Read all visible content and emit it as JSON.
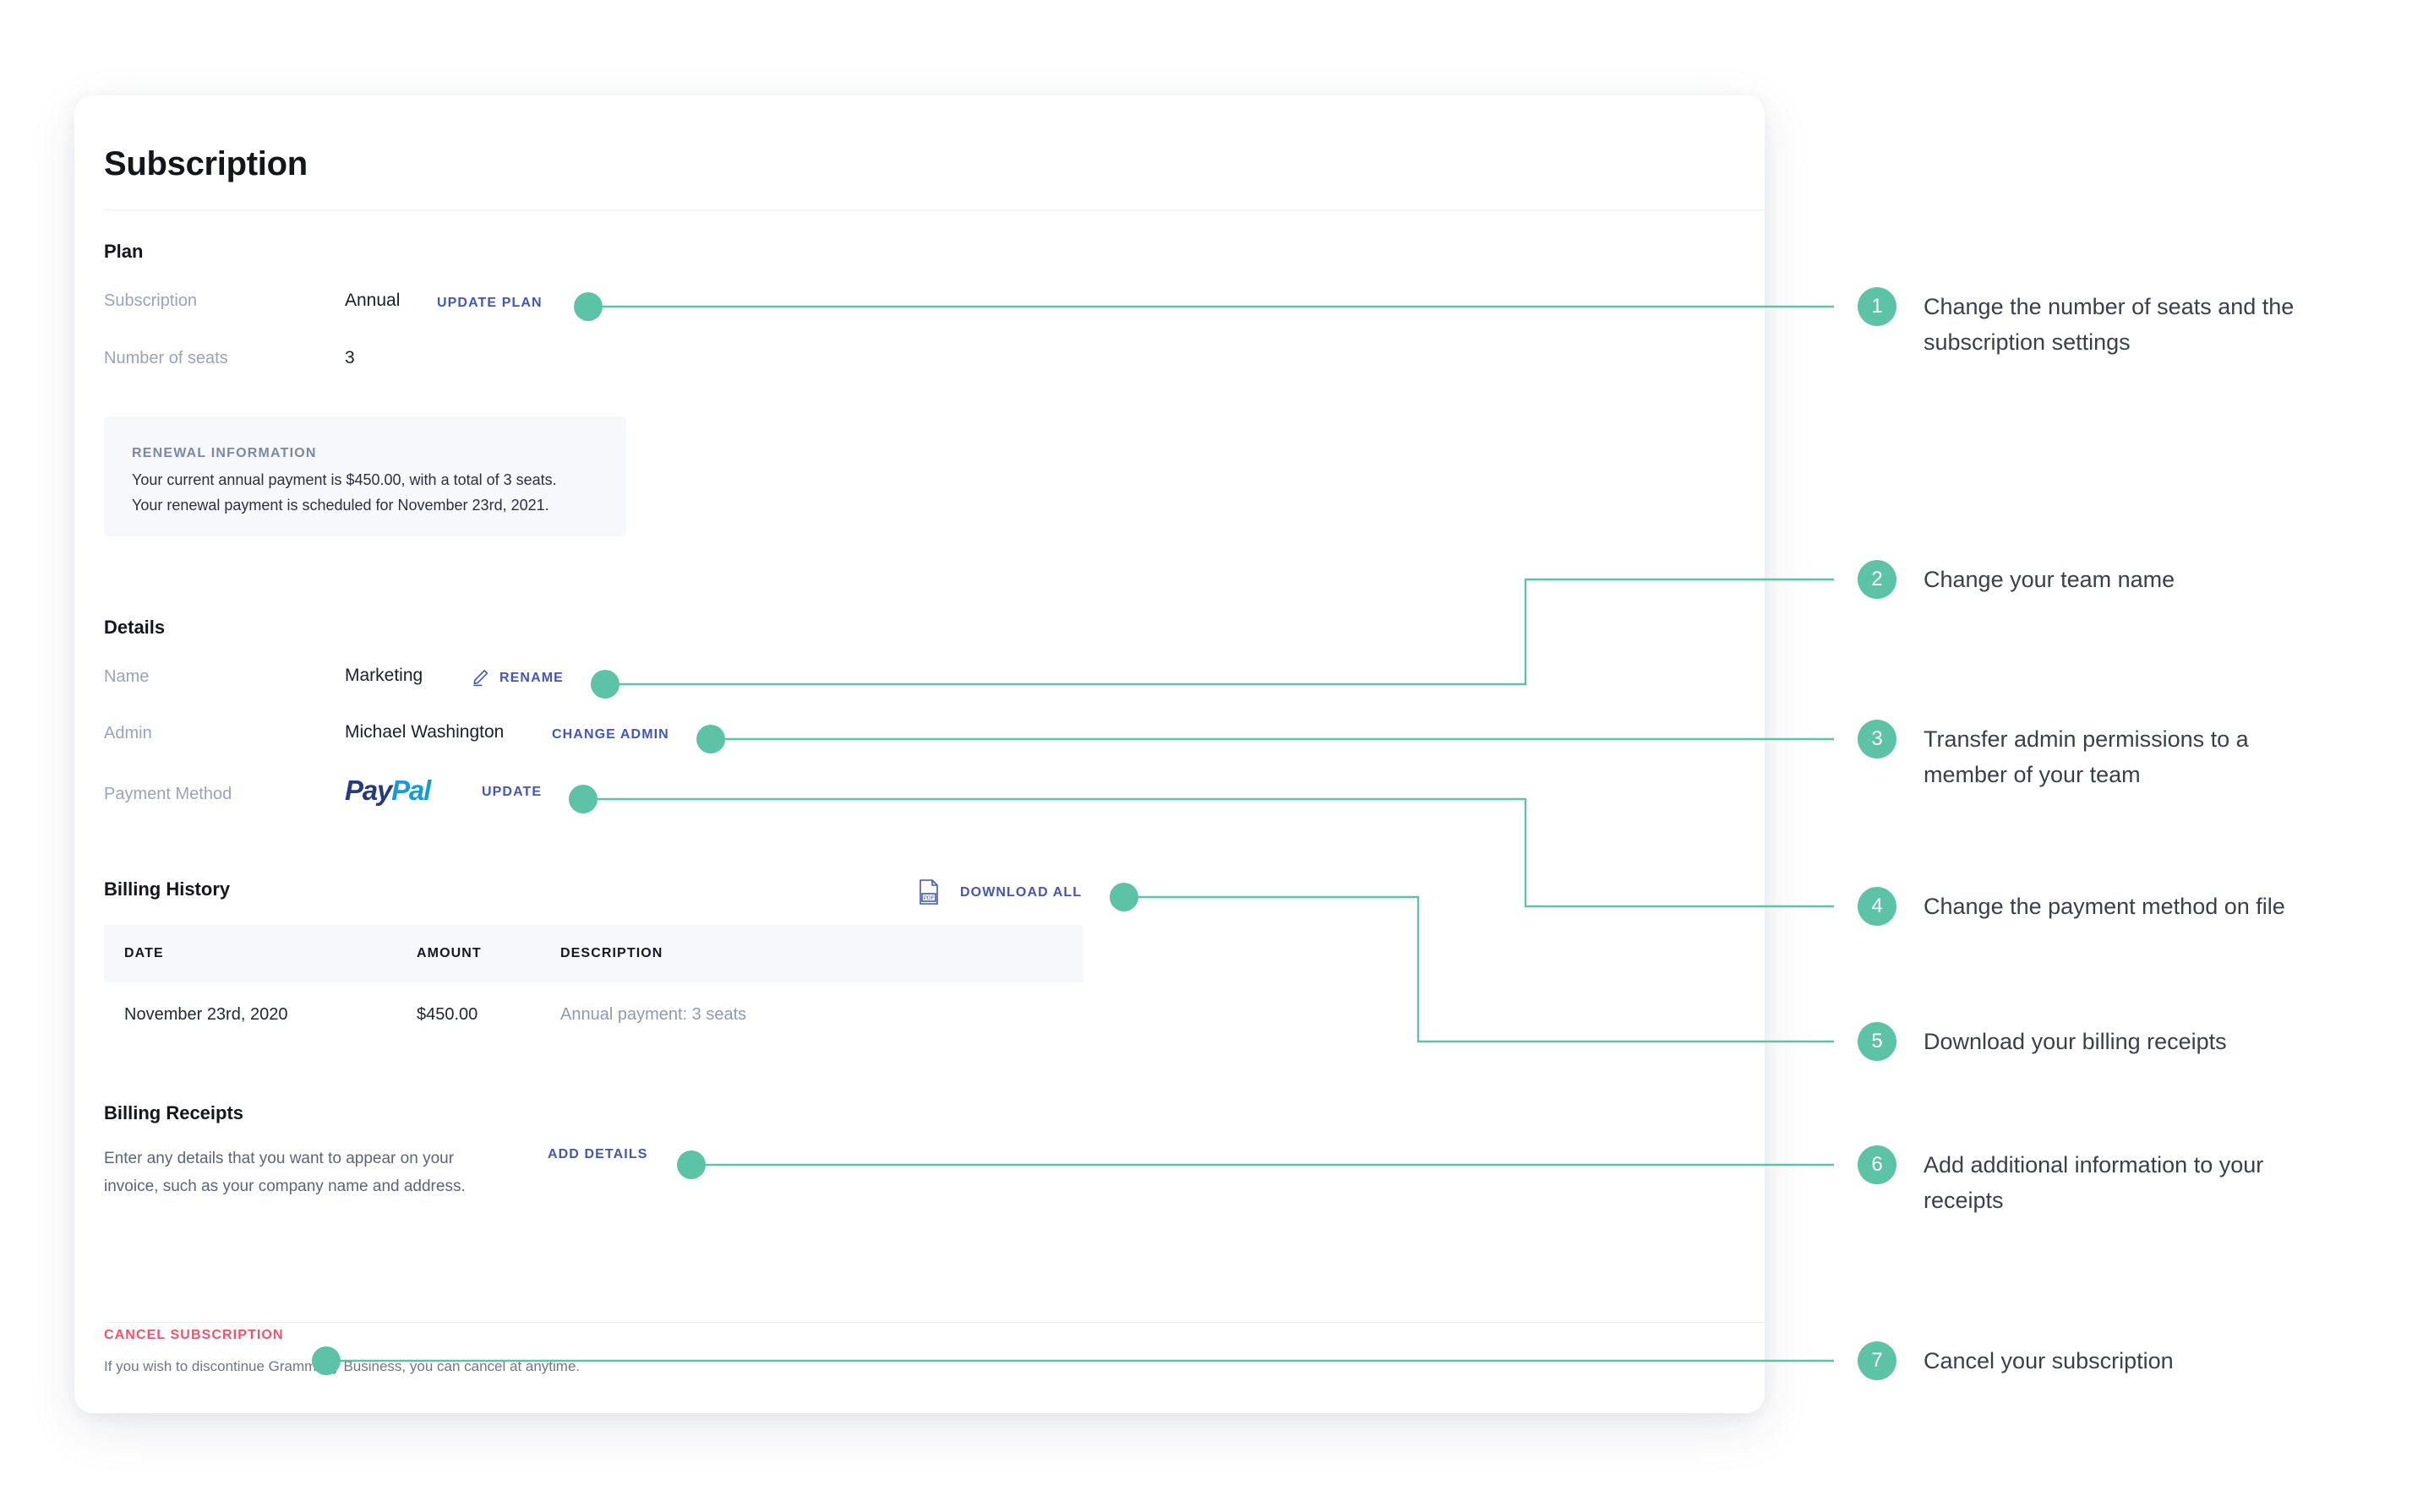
{
  "card": {
    "title": "Subscription",
    "plan": {
      "heading": "Plan",
      "rows": [
        {
          "label": "Subscription",
          "value": "Annual",
          "action": "UPDATE PLAN"
        },
        {
          "label": "Number of seats",
          "value": "3",
          "action": ""
        }
      ],
      "renewal": {
        "title": "RENEWAL INFORMATION",
        "line1": "Your current annual payment is $450.00, with a total of 3 seats.",
        "line2": "Your renewal payment is scheduled for November 23rd, 2021."
      }
    },
    "details": {
      "heading": "Details",
      "name_label": "Name",
      "name_value": "Marketing",
      "rename_action": "RENAME",
      "admin_label": "Admin",
      "admin_value": "Michael Washington",
      "change_admin_action": "CHANGE ADMIN",
      "payment_label": "Payment Method",
      "payment_brand_dark": "Pay",
      "payment_brand_light": "Pal",
      "update_action": "UPDATE"
    },
    "billing_history": {
      "heading": "Billing History",
      "download_all_action": "DOWNLOAD ALL",
      "columns": [
        "DATE",
        "AMOUNT",
        "DESCRIPTION"
      ],
      "rows": [
        {
          "date": "November 23rd, 2020",
          "amount": "$450.00",
          "description": "Annual payment: 3 seats"
        }
      ]
    },
    "billing_receipts": {
      "heading": "Billing Receipts",
      "body": "Enter any details that you want to appear on your invoice, such as your company name and address.",
      "add_details_action": "ADD DETAILS"
    },
    "cancel": {
      "action": "CANCEL SUBSCRIPTION",
      "note": "If you wish to discontinue Grammarly Business, you can cancel at anytime."
    }
  },
  "callouts": [
    {
      "number": "1",
      "text": "Change the number of seats and the subscription settings"
    },
    {
      "number": "2",
      "text": "Change your team name"
    },
    {
      "number": "3",
      "text": "Transfer admin permissions to a member of your team"
    },
    {
      "number": "4",
      "text": "Change the payment method on file"
    },
    {
      "number": "5",
      "text": "Download your billing receipts"
    },
    {
      "number": "6",
      "text": "Add additional information to your receipts"
    },
    {
      "number": "7",
      "text": "Cancel your subscription"
    }
  ],
  "colors": {
    "accent_teal": "#5dc3a7",
    "link_blue": "#4356b8",
    "danger_red": "#f0536a",
    "paypal_dark": "#253b80",
    "paypal_light": "#179bd7"
  }
}
